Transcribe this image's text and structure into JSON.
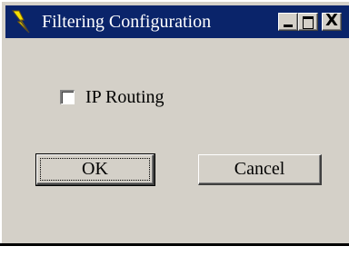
{
  "window": {
    "title": "Filtering Configuration",
    "icon": "lightning-bolt-icon",
    "controls": {
      "minimize": "_",
      "maximize": "□",
      "close": "X"
    }
  },
  "options": {
    "ip_routing_label": "IP Routing",
    "ip_routing_checked": false
  },
  "buttons": {
    "ok_label": "OK",
    "cancel_label": "Cancel"
  },
  "colors": {
    "titlebar": "#0a246a",
    "face": "#d4d0c8",
    "title_text": "#ffffff"
  }
}
